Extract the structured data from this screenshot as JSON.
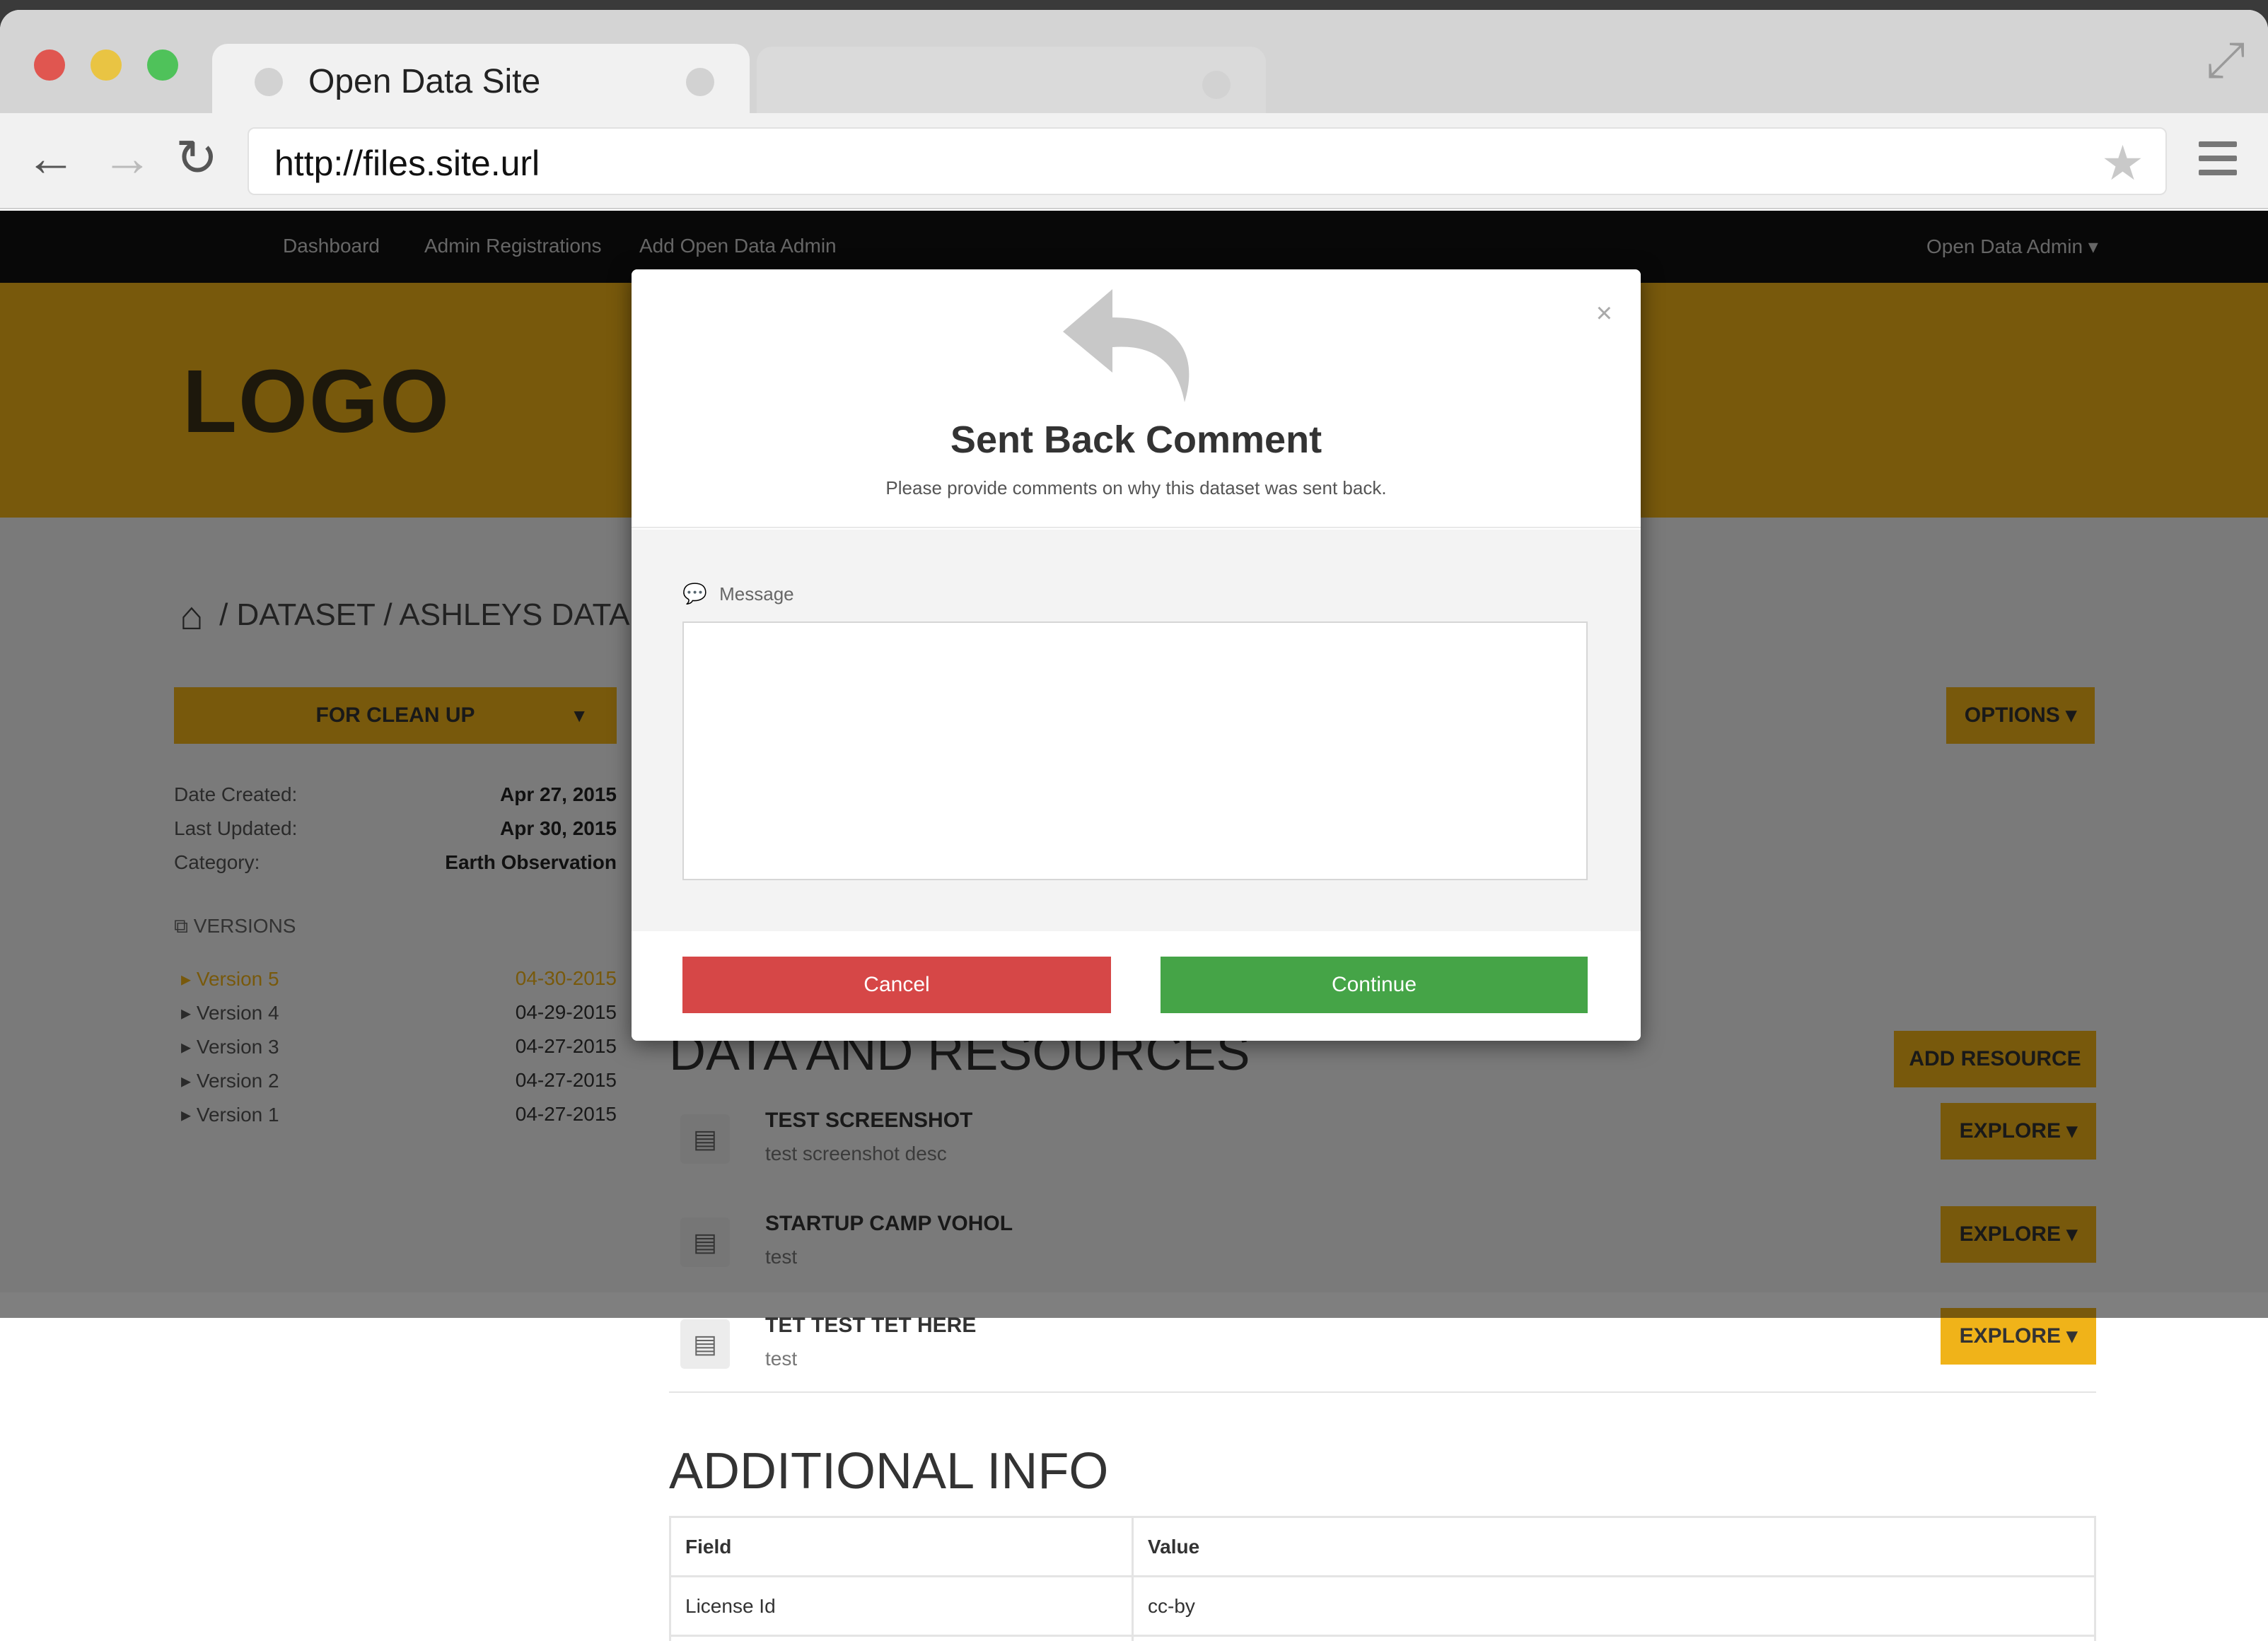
{
  "browser": {
    "tab_title": "Open Data Site",
    "url": "http://files.site.url"
  },
  "topnav": {
    "items": [
      "Dashboard",
      "Admin Registrations",
      "Add Open Data Admin"
    ],
    "user_menu": "Open Data Admin ▾"
  },
  "hero": {
    "logo": "LOGO"
  },
  "breadcrumb": {
    "sep": "/",
    "items": [
      "DATASET",
      "ASHLEYS DATA"
    ]
  },
  "sidebar": {
    "status_button": "FOR CLEAN UP",
    "meta": [
      {
        "label": "Date Created:",
        "value": "Apr 27, 2015"
      },
      {
        "label": "Last Updated:",
        "value": "Apr 30, 2015"
      },
      {
        "label": "Category:",
        "value": "Earth Observation"
      }
    ],
    "versions_heading": "VERSIONS",
    "versions": [
      {
        "name": "Version 5",
        "date": "04-30-2015"
      },
      {
        "name": "Version 4",
        "date": "04-29-2015"
      },
      {
        "name": "Version 3",
        "date": "04-27-2015"
      },
      {
        "name": "Version 2",
        "date": "04-27-2015"
      },
      {
        "name": "Version 1",
        "date": "04-27-2015"
      }
    ]
  },
  "main": {
    "options_button": "OPTIONS ▾",
    "resources_heading": "DATA AND RESOURCES",
    "add_resource_button": "ADD RESOURCE",
    "explore_label": "EXPLORE ▾",
    "resources": [
      {
        "title": "TEST SCREENSHOT",
        "desc": "test screenshot desc"
      },
      {
        "title": "STARTUP CAMP VOHOL",
        "desc": "test"
      },
      {
        "title": "TET TEST TET HERE",
        "desc": "test"
      }
    ],
    "additional_heading": "ADDITIONAL INFO",
    "table": {
      "headers": [
        "Field",
        "Value"
      ],
      "rows": [
        [
          "License Id",
          "cc-by"
        ],
        [
          "",
          ""
        ]
      ]
    }
  },
  "modal": {
    "close": "×",
    "title": "Sent Back Comment",
    "subtitle": "Please provide comments on why this dataset was sent back.",
    "message_label": "Message",
    "message_value": "",
    "cancel_label": "Cancel",
    "continue_label": "Continue"
  },
  "colors": {
    "accent": "#f0b319",
    "cancel": "#d64747",
    "continue": "#45a447"
  }
}
